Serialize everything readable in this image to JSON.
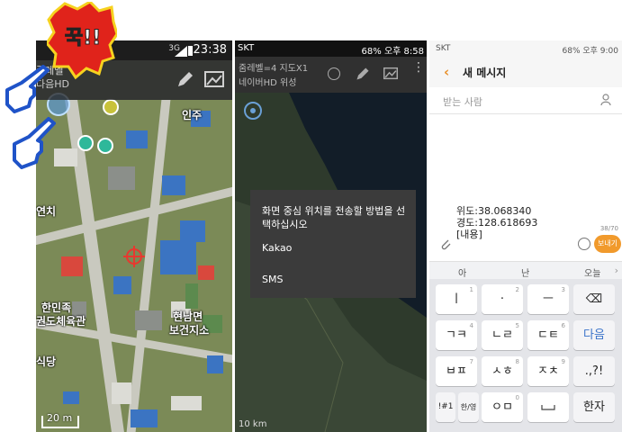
{
  "annotation": {
    "badge_text": "꾹!!"
  },
  "panel1": {
    "status": {
      "network": "3G",
      "time": "23:38"
    },
    "toolbar": {
      "zoom_label": "줌레벨",
      "layer_label": "다음HD"
    },
    "labels": {
      "inju": "인주",
      "yeonchi": "연치",
      "hanmin": "한민족",
      "gwondo": "권도체육관",
      "hyeonnam1": "현남면",
      "hyeonnam2": "보건지소",
      "sikdang": "식당"
    },
    "scale_text": "20 m"
  },
  "panel2": {
    "status": {
      "carrier": "SKT",
      "right_text": "68% 오후 8:58"
    },
    "toolbar": {
      "zoom_label": "줌레벨=4 지도X1",
      "layer_label": "네이버HD 위성"
    },
    "dialog": {
      "title": "화면 중심 위치를 전송할 방법을 선택하십시오",
      "options": [
        "Kakao",
        "SMS"
      ]
    },
    "scale_text": "10 km"
  },
  "panel3": {
    "status": {
      "carrier": "SKT",
      "right_text": "68% 오후 9:00"
    },
    "header": {
      "title": "새 메시지"
    },
    "recipient_placeholder": "받는 사람",
    "message_lines": [
      "위도:38.068340",
      "경도:128.618693",
      "[내용]"
    ],
    "char_counter": "38/70",
    "send_label": "보내기",
    "suggestions": [
      "아",
      "난",
      "오늘"
    ],
    "keys": [
      [
        {
          "label": "ㅣ",
          "sup": "1"
        },
        {
          "label": "·",
          "sup": "2"
        },
        {
          "label": "ㅡ",
          "sup": "3"
        },
        {
          "label": "⌫",
          "sup": ""
        }
      ],
      [
        {
          "label": "ㄱㅋ",
          "sup": "4"
        },
        {
          "label": "ㄴㄹ",
          "sup": "5"
        },
        {
          "label": "ㄷㅌ",
          "sup": "6"
        },
        {
          "label": "다음",
          "sup": ""
        }
      ],
      [
        {
          "label": "ㅂㅍ",
          "sup": "7"
        },
        {
          "label": "ㅅㅎ",
          "sup": "8"
        },
        {
          "label": "ㅈㅊ",
          "sup": "9"
        },
        {
          "label": ".,?!",
          "sup": ""
        }
      ],
      [
        {
          "label": "!#1",
          "sup": ""
        },
        {
          "label": "한/영",
          "sup": ""
        },
        {
          "label": "ㅇㅁ",
          "sup": "0"
        },
        {
          "label": "",
          "sup": ""
        },
        {
          "label": "한자",
          "sup": ""
        }
      ]
    ]
  },
  "colors": {
    "accent_orange": "#f19a2c",
    "badge_red": "#e0231b",
    "hand_blue": "#1f53c8"
  }
}
